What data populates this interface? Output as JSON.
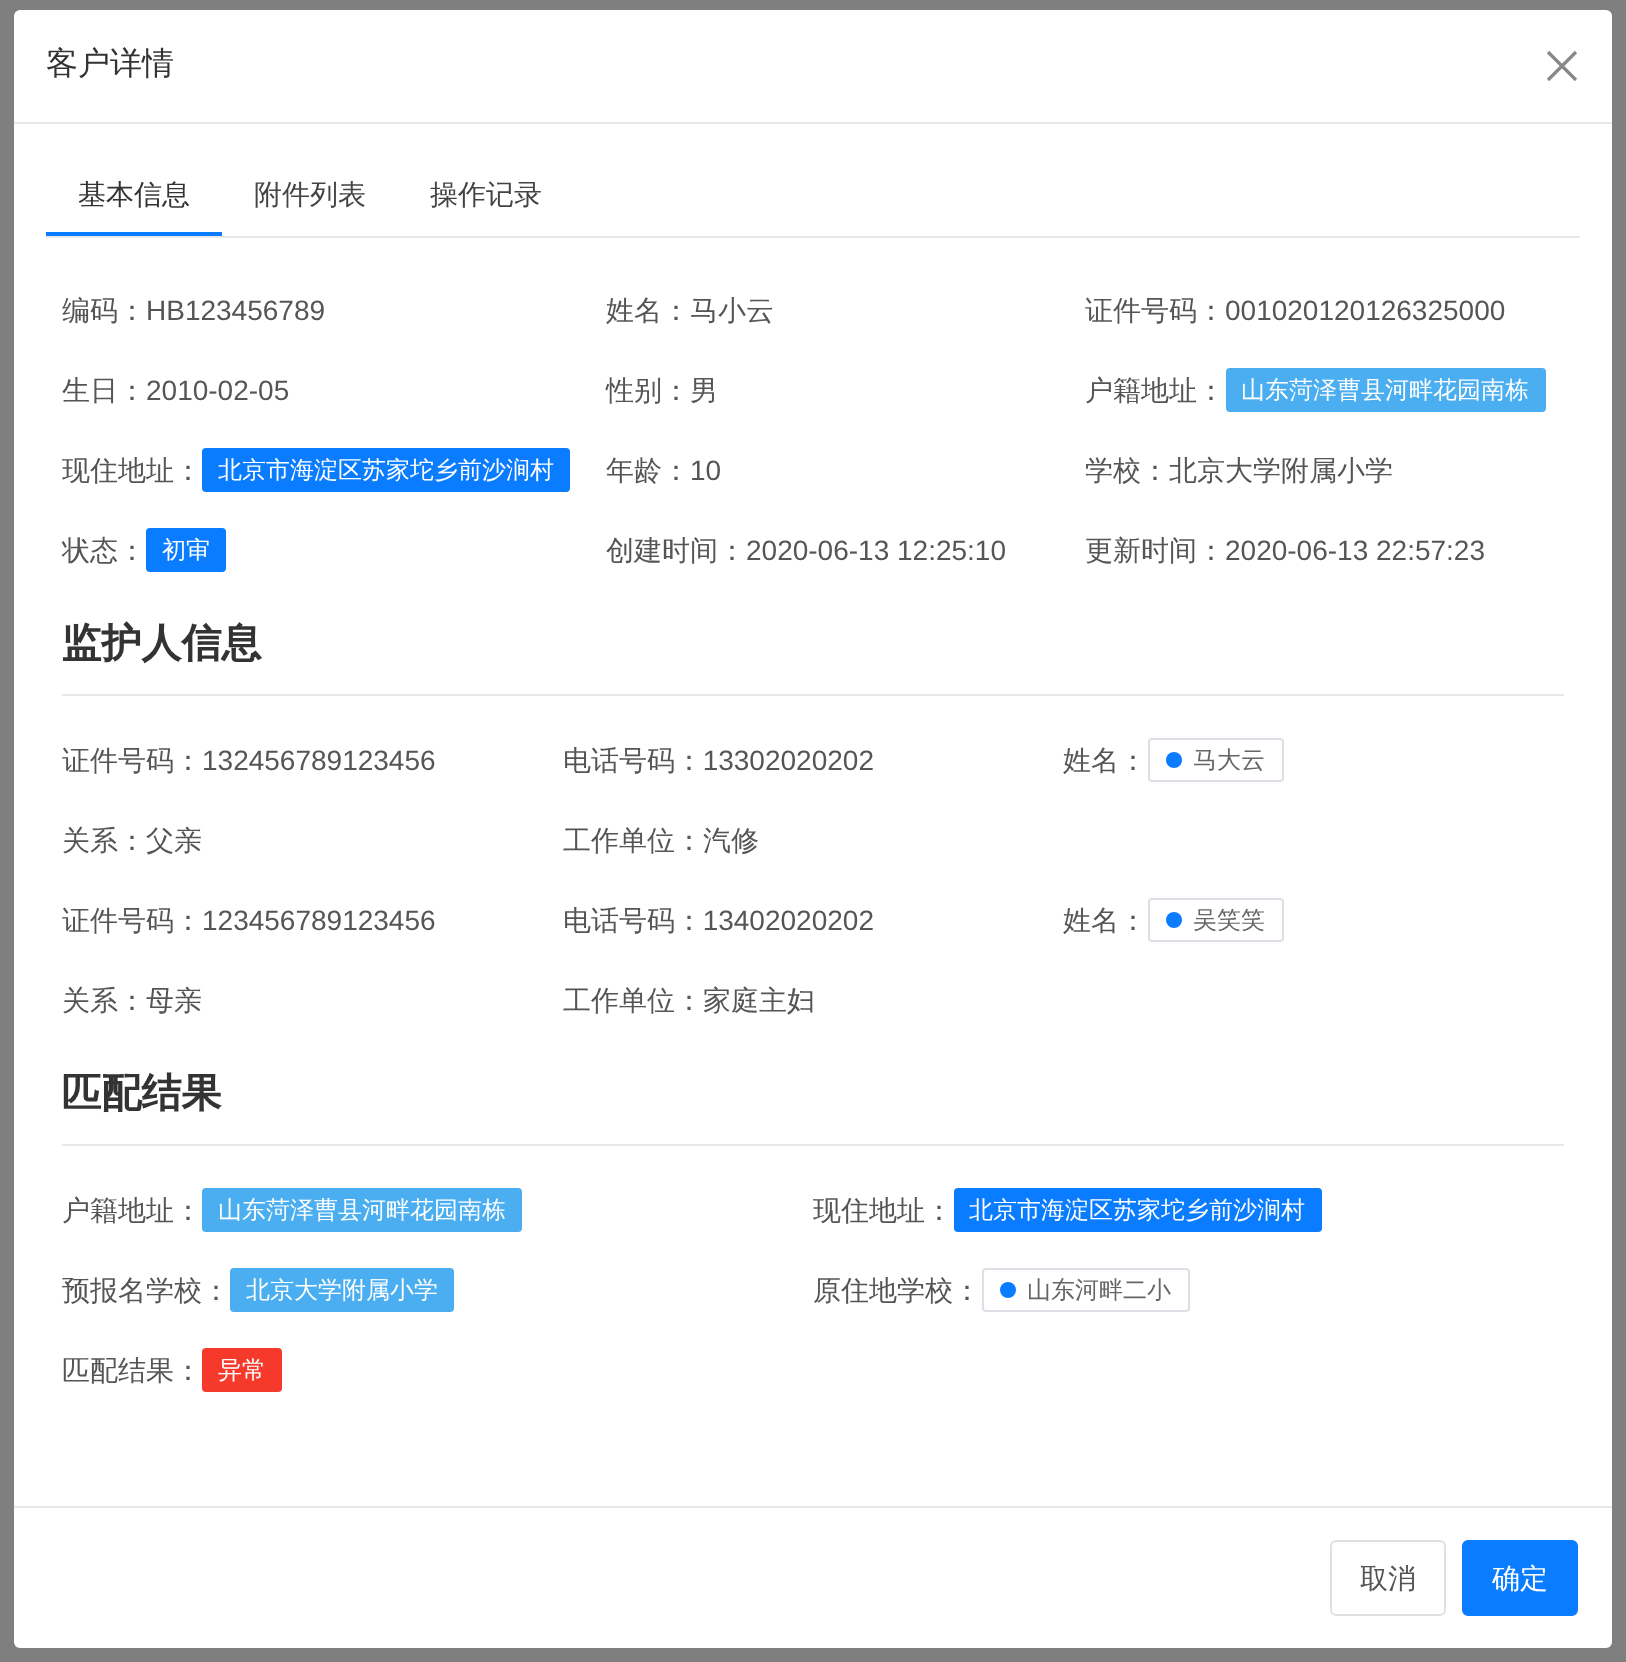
{
  "dialog": {
    "title": "客户详情"
  },
  "tabs": [
    {
      "label": "基本信息",
      "selected": true
    },
    {
      "label": "附件列表",
      "selected": false
    },
    {
      "label": "操作记录",
      "selected": false
    }
  ],
  "basic": [
    {
      "label": "编码：",
      "kind": "text",
      "value": "HB123456789"
    },
    {
      "label": "姓名：",
      "kind": "text",
      "value": "马小云"
    },
    {
      "label": "证件号码：",
      "kind": "text",
      "value": "001020120126325000"
    },
    {
      "label": "生日：",
      "kind": "text",
      "value": "2010-02-05"
    },
    {
      "label": "性别：",
      "kind": "text",
      "value": "男"
    },
    {
      "label": "户籍地址：",
      "kind": "tag",
      "value": "山东菏泽曹县河畔花园南栋",
      "color": "#4aaef0"
    },
    {
      "label": "现住地址：",
      "kind": "tag",
      "value": "北京市海淀区苏家坨乡前沙涧村",
      "color": "#0a7cff"
    },
    {
      "label": "年龄：",
      "kind": "text",
      "value": "10"
    },
    {
      "label": "学校：",
      "kind": "text",
      "value": "北京大学附属小学"
    },
    {
      "label": "状态：",
      "kind": "tag",
      "value": "初审",
      "color": "#0a7cff"
    },
    {
      "label": "创建时间：",
      "kind": "text",
      "value": "2020-06-13 12:25:10"
    },
    {
      "label": "更新时间：",
      "kind": "text",
      "value": "2020-06-13 22:57:23"
    }
  ],
  "guardian": {
    "title": "监护人信息",
    "fields": [
      {
        "label": "证件号码：",
        "kind": "text",
        "value": "132456789123456"
      },
      {
        "label": "电话号码：",
        "kind": "text",
        "value": "13302020202"
      },
      {
        "label": "姓名：",
        "kind": "dot-tag",
        "value": "马大云",
        "color": "#0a7cff"
      },
      {
        "label": "关系：",
        "kind": "text",
        "value": "父亲"
      },
      {
        "label": "工作单位：",
        "kind": "text",
        "value": "汽修"
      },
      {
        "kind": "empty"
      },
      {
        "label": "证件号码：",
        "kind": "text",
        "value": "123456789123456"
      },
      {
        "label": "电话号码：",
        "kind": "text",
        "value": "13402020202"
      },
      {
        "label": "姓名：",
        "kind": "dot-tag",
        "value": "吴笑笑",
        "color": "#0a7cff"
      },
      {
        "label": "关系：",
        "kind": "text",
        "value": "母亲"
      },
      {
        "label": "工作单位：",
        "kind": "text",
        "value": "家庭主妇"
      }
    ]
  },
  "match": {
    "title": "匹配结果",
    "fields": [
      {
        "label": "户籍地址：",
        "kind": "tag",
        "value": "山东菏泽曹县河畔花园南栋",
        "color": "#4aaef0"
      },
      {
        "label": "现住地址：",
        "kind": "tag",
        "value": "北京市海淀区苏家坨乡前沙涧村",
        "color": "#0a7cff"
      },
      {
        "label": "预报名学校：",
        "kind": "tag",
        "value": "北京大学附属小学",
        "color": "#4aaef0"
      },
      {
        "label": "原住地学校：",
        "kind": "dot-tag",
        "value": "山东河畔二小",
        "color": "#0a7cff"
      },
      {
        "label": "匹配结果：",
        "kind": "tag",
        "value": "异常",
        "color": "#f5392b"
      }
    ]
  },
  "buttons": [
    {
      "label": "取消",
      "kind": "default"
    },
    {
      "label": "确定",
      "kind": "primary"
    }
  ]
}
